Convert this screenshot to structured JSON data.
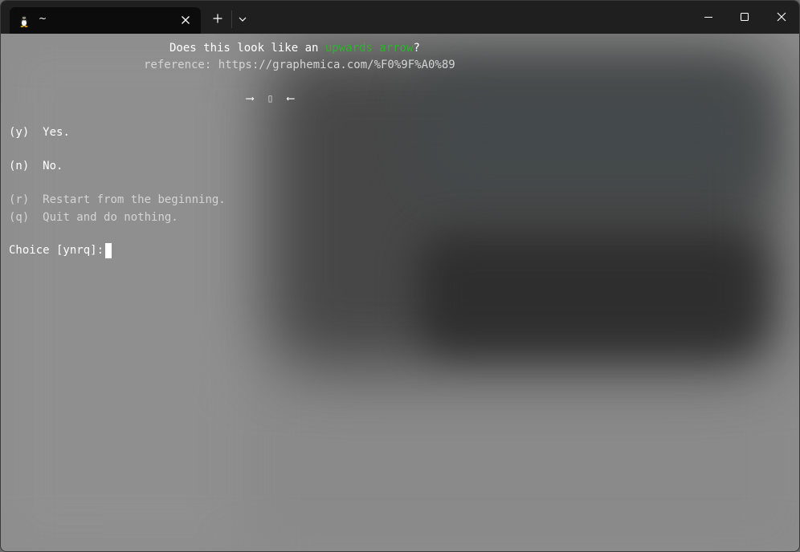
{
  "window": {
    "tab_title": "~",
    "tab_icon": "linux-penguin-icon",
    "controls": [
      "minimize-icon",
      "maximize-icon",
      "close-icon"
    ]
  },
  "prompt": {
    "question_prefix": "Does this look like an ",
    "question_highlight": "upwards arrow",
    "question_suffix": "?",
    "reference": "reference: https://graphemica.com/%F0%9F%A0%89",
    "glyph_left_arrow": "⟶",
    "glyph_symbol": "▯",
    "glyph_right_arrow": "⟵"
  },
  "options": {
    "yes_key": "(y)",
    "yes_label": "Yes.",
    "no_key": "(n)",
    "no_label": "No.",
    "restart_key": "(r)",
    "restart_label": "Restart from the beginning.",
    "quit_key": "(q)",
    "quit_label": "Quit and do nothing."
  },
  "input": {
    "label": "Choice [ynrq]:"
  },
  "colors": {
    "highlight": "#2bb52b",
    "titlebar": "#1f1f1f",
    "active_tab": "#0c0c0c"
  }
}
